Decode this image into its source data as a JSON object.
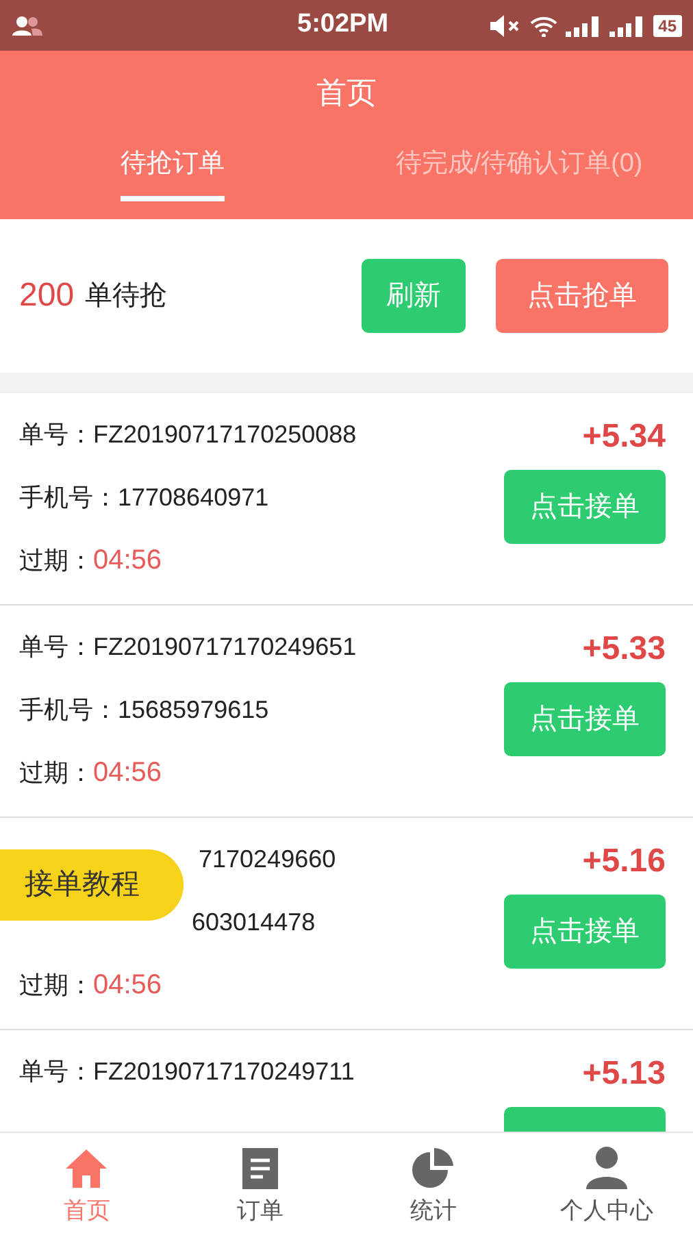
{
  "status_bar": {
    "time": "5:02PM",
    "battery": "45"
  },
  "header": {
    "title": "首页"
  },
  "tabs": [
    {
      "label": "待抢订单",
      "selected": true
    },
    {
      "label": "待完成/待确认订单(0)",
      "selected": false
    }
  ],
  "summary": {
    "count": "200",
    "label": "单待抢",
    "buttons": [
      {
        "label": "刷新",
        "kind": "refresh"
      },
      {
        "label": "点击抢单",
        "kind": "grab"
      }
    ]
  },
  "orders": [
    {
      "order_label": "单号：",
      "order_no": "FZ20190717170250088",
      "phone_label": "手机号：",
      "phone": "17708640971",
      "expiry_label": "过期：",
      "expiry": "04:56",
      "amount": "+5.34",
      "button": "点击接单"
    },
    {
      "order_label": "单号：",
      "order_no": "FZ20190717170249651",
      "phone_label": "手机号：",
      "phone": "15685979615",
      "expiry_label": "过期：",
      "expiry": "04:56",
      "amount": "+5.33",
      "button": "点击接单"
    },
    {
      "order_no": "7170249660",
      "phone": "603014478",
      "expiry_label": "过期：",
      "expiry": "04:56",
      "amount": "+5.16",
      "button": "点击接单"
    },
    {
      "order_label": "单号：",
      "order_no": "FZ20190717170249711",
      "amount": "+5.13"
    }
  ],
  "floating_button": {
    "label": "接单教程"
  },
  "bottom_nav": [
    {
      "label": "首页",
      "selected": true
    },
    {
      "label": "订单",
      "selected": false
    },
    {
      "label": "统计",
      "selected": false
    },
    {
      "label": "个人中心",
      "selected": false
    }
  ]
}
